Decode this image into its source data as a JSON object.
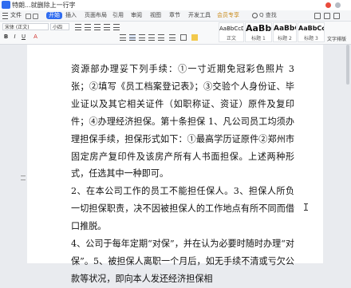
{
  "window": {
    "title": "特朗...就删除上一行字"
  },
  "tabs": [
    "开始",
    "插入",
    "页面布局",
    "引用",
    "审阅",
    "视图",
    "章节",
    "开发工具",
    "会员专享"
  ],
  "active_tab": "开始",
  "file_label": "文件",
  "search_text": "Q 查找",
  "ribbon": {
    "font_name": "宋体 (正文)",
    "font_size": "小四",
    "format_buttons": [
      "B",
      "I",
      "U",
      "A"
    ],
    "styles": [
      {
        "sample": "AaBbCcDd",
        "name": "正文"
      },
      {
        "sample": "AaBb",
        "name": "标题 1"
      },
      {
        "sample": "AaBbC",
        "name": "标题 2"
      },
      {
        "sample": "AaBbCc",
        "name": "标题 3"
      }
    ],
    "text_tools": "文字排版"
  },
  "document": {
    "paragraphs": [
      "资源部办理妥下列手续：①一寸近期免冠彩色照片 3 张；②填写《员工档案登记表》；③交验个人身份证、毕业证以及其它相关证件（如职称证、资证）原件及复印件；④办理经济担保。第十条担保 1、凡公司员工均须办理担保手续，担保形式如下：①最高学历证原件②郑州市固定房产复印件及该房产所有人书面担保。上述两种形式，任选其中一种即可。",
      "2、在本公司工作的员工不能担任保人。3、担保人所负一切担保职责，决不因被担保人的工作地点有所不同而借口推脱。",
      "4、公司于每年定期“对保”，并在认为必要时随时办理“对保”。5、被担保人离职一个月后，如无手续不清或亏欠公款等状况，即向本人发还经济担保相"
    ]
  }
}
